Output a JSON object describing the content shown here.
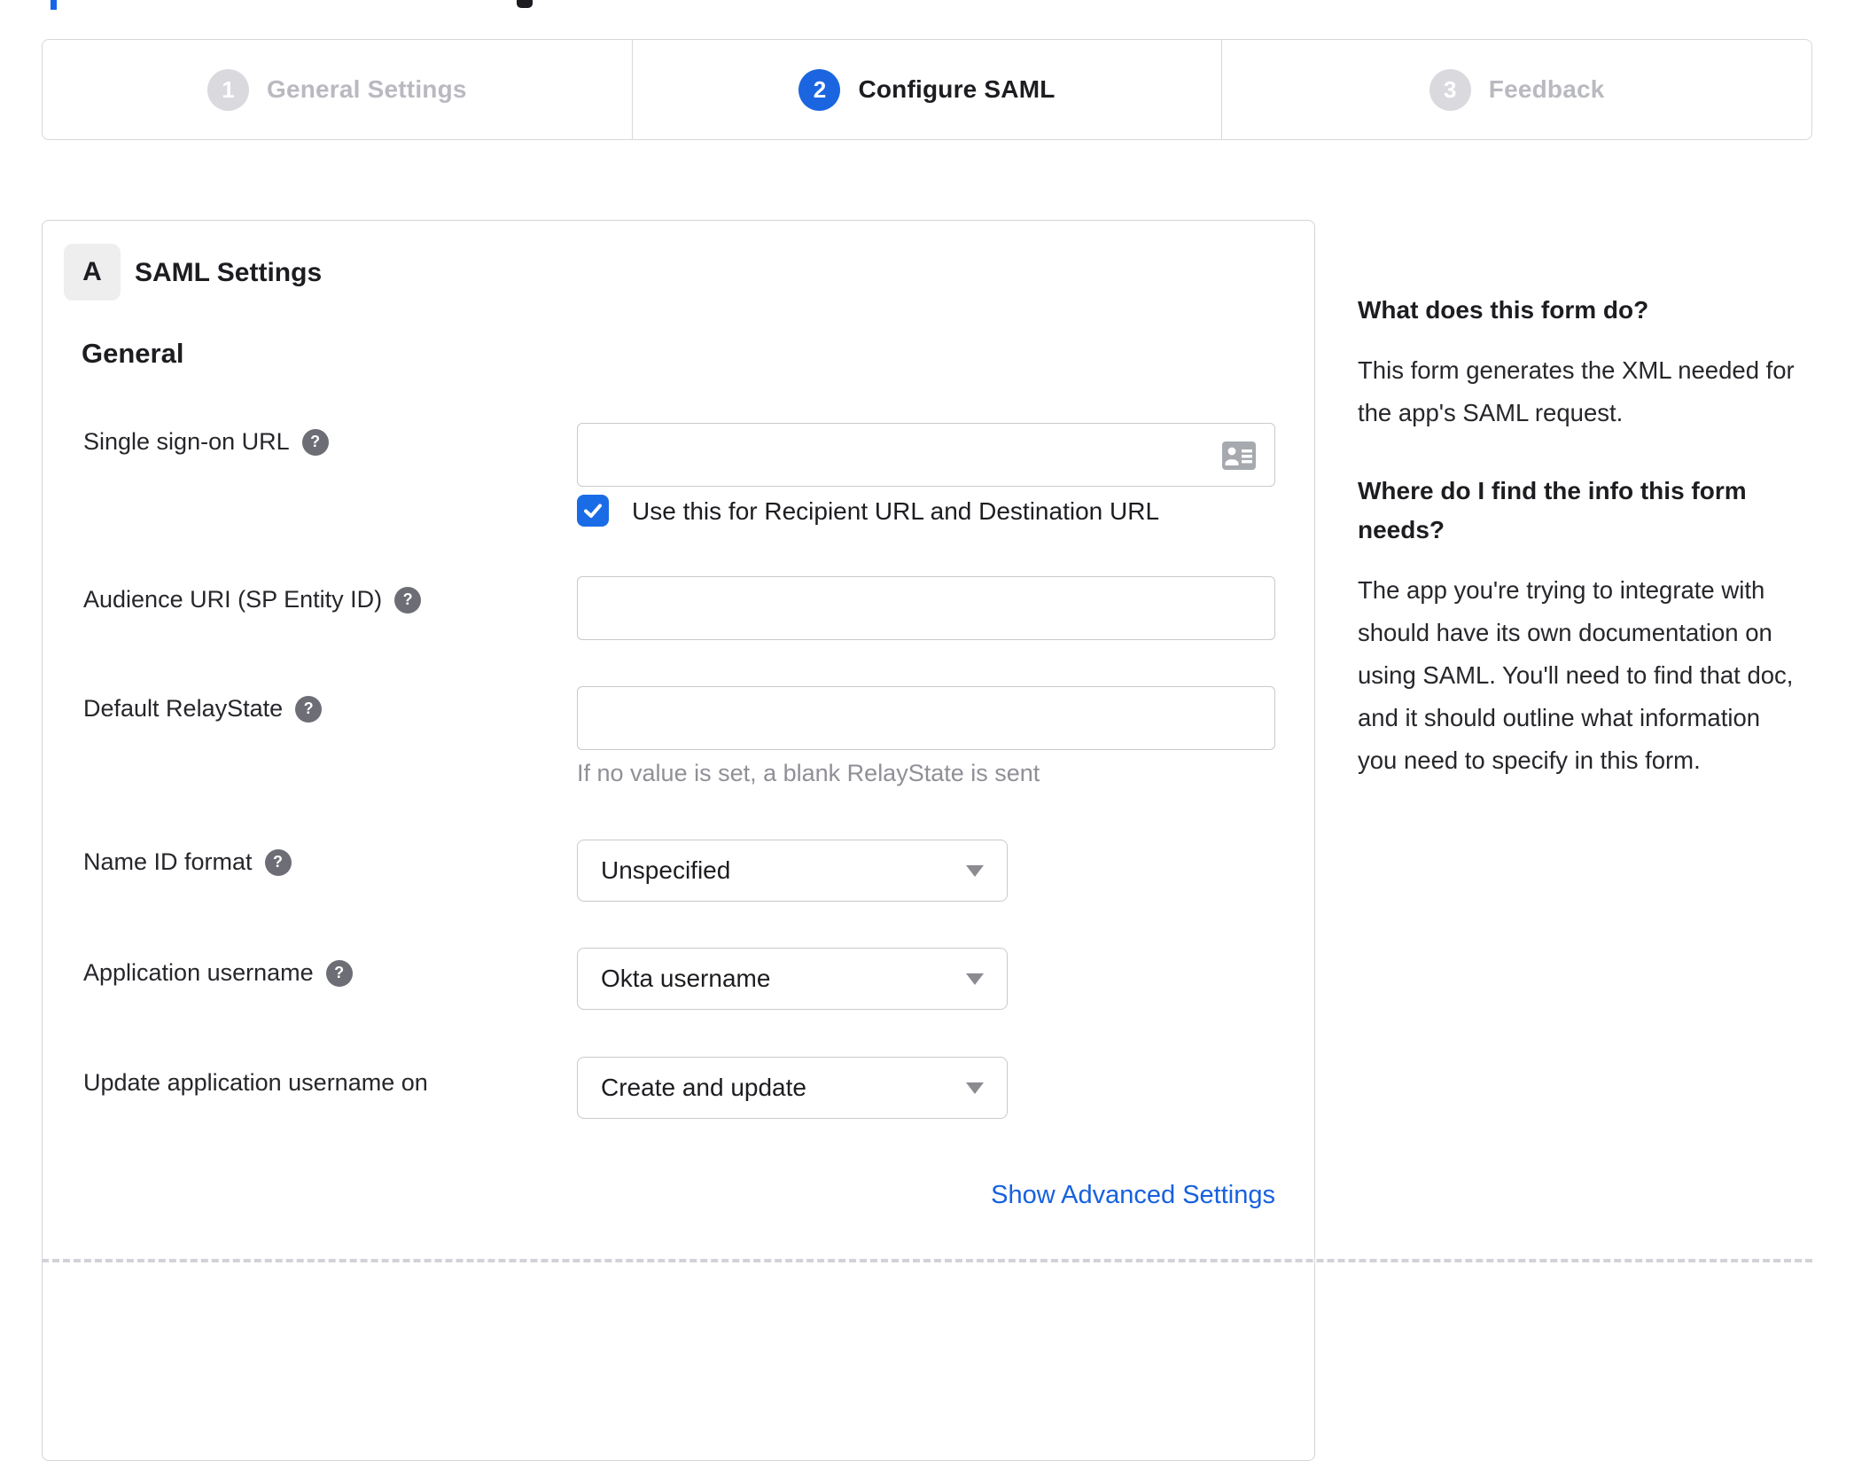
{
  "stepper": {
    "steps": [
      {
        "number": "1",
        "label": "General Settings",
        "state": "inactive"
      },
      {
        "number": "2",
        "label": "Configure SAML",
        "state": "active"
      },
      {
        "number": "3",
        "label": "Feedback",
        "state": "inactive"
      }
    ]
  },
  "form": {
    "section_badge": "A",
    "section_title": "SAML Settings",
    "group_title": "General",
    "help_glyph": "?",
    "sso": {
      "label": "Single sign-on URL",
      "value": "",
      "checkbox_label": "Use this for Recipient URL and Destination URL",
      "checked": true
    },
    "audience": {
      "label": "Audience URI (SP Entity ID)",
      "value": ""
    },
    "relay_state": {
      "label": "Default RelayState",
      "value": "",
      "hint": "If no value is set, a blank RelayState is sent"
    },
    "name_id": {
      "label": "Name ID format",
      "value": "Unspecified"
    },
    "app_username": {
      "label": "Application username",
      "value": "Okta username"
    },
    "update_username": {
      "label": "Update application username on",
      "value": "Create and update"
    },
    "advanced_link": "Show Advanced Settings"
  },
  "help_panel": {
    "section1": {
      "title": "What does this form do?",
      "body": "This form generates the XML needed for the app's SAML request."
    },
    "section2": {
      "title": "Where do I find the info this form needs?",
      "body": "The app you're trying to integrate with should have its own documentation on using SAML. You'll need to find that doc, and it should outline what information you need to specify in this form."
    }
  },
  "colors": {
    "accent_blue": "#1b66e0",
    "checkbox_blue": "#1a6ce6",
    "link_blue": "#1661de",
    "inactive_grey": "#d9d9de"
  }
}
